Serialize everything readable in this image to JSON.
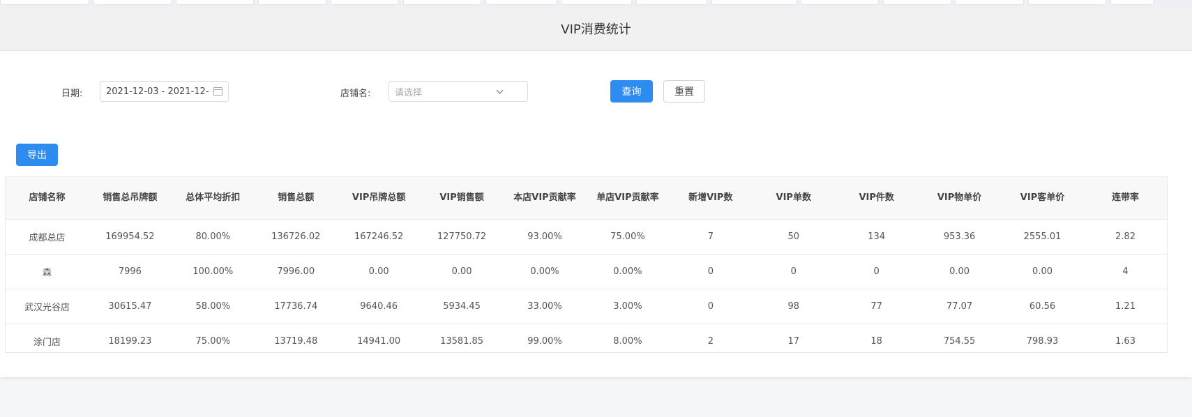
{
  "page": {
    "title": "VIP消费统计"
  },
  "filters": {
    "date_label": "日期:",
    "date_value": "2021-12-03 - 2021-12-",
    "shop_label": "店铺名:",
    "shop_placeholder": "请选择",
    "query_button": "查询",
    "reset_button": "重置",
    "export_button": "导出"
  },
  "table": {
    "columns": [
      "店铺名称",
      "销售总吊牌额",
      "总体平均折扣",
      "销售总额",
      "VIP吊牌总额",
      "VIP销售额",
      "本店VIP贡献率",
      "单店VIP贡献率",
      "新增VIP数",
      "VIP单数",
      "VIP件数",
      "VIP物单价",
      "VIP客单价",
      "连带率"
    ],
    "rows": [
      [
        "成都总店",
        "169954.52",
        "80.00%",
        "136726.02",
        "167246.52",
        "127750.72",
        "93.00%",
        "75.00%",
        "7",
        "50",
        "134",
        "953.36",
        "2555.01",
        "2.82"
      ],
      [
        "森",
        "7996",
        "100.00%",
        "7996.00",
        "0.00",
        "0.00",
        "0.00%",
        "0.00%",
        "0",
        "0",
        "0",
        "0.00",
        "0.00",
        "4"
      ],
      [
        "武汉光谷店",
        "30615.47",
        "58.00%",
        "17736.74",
        "9640.46",
        "5934.45",
        "33.00%",
        "3.00%",
        "0",
        "98",
        "77",
        "77.07",
        "60.56",
        "1.21"
      ],
      [
        "涂门店",
        "18199.23",
        "75.00%",
        "13719.48",
        "14941.00",
        "13581.85",
        "99.00%",
        "8.00%",
        "2",
        "17",
        "18",
        "754.55",
        "798.93",
        "1.63"
      ]
    ]
  },
  "colors": {
    "primary": "#2d8cf0",
    "title_bar_bg": "#f1f1f1",
    "page_bg": "#f5f6f8"
  },
  "icons": {
    "date_field": "calendar-icon",
    "shop_select": "chevron-down-icon"
  }
}
